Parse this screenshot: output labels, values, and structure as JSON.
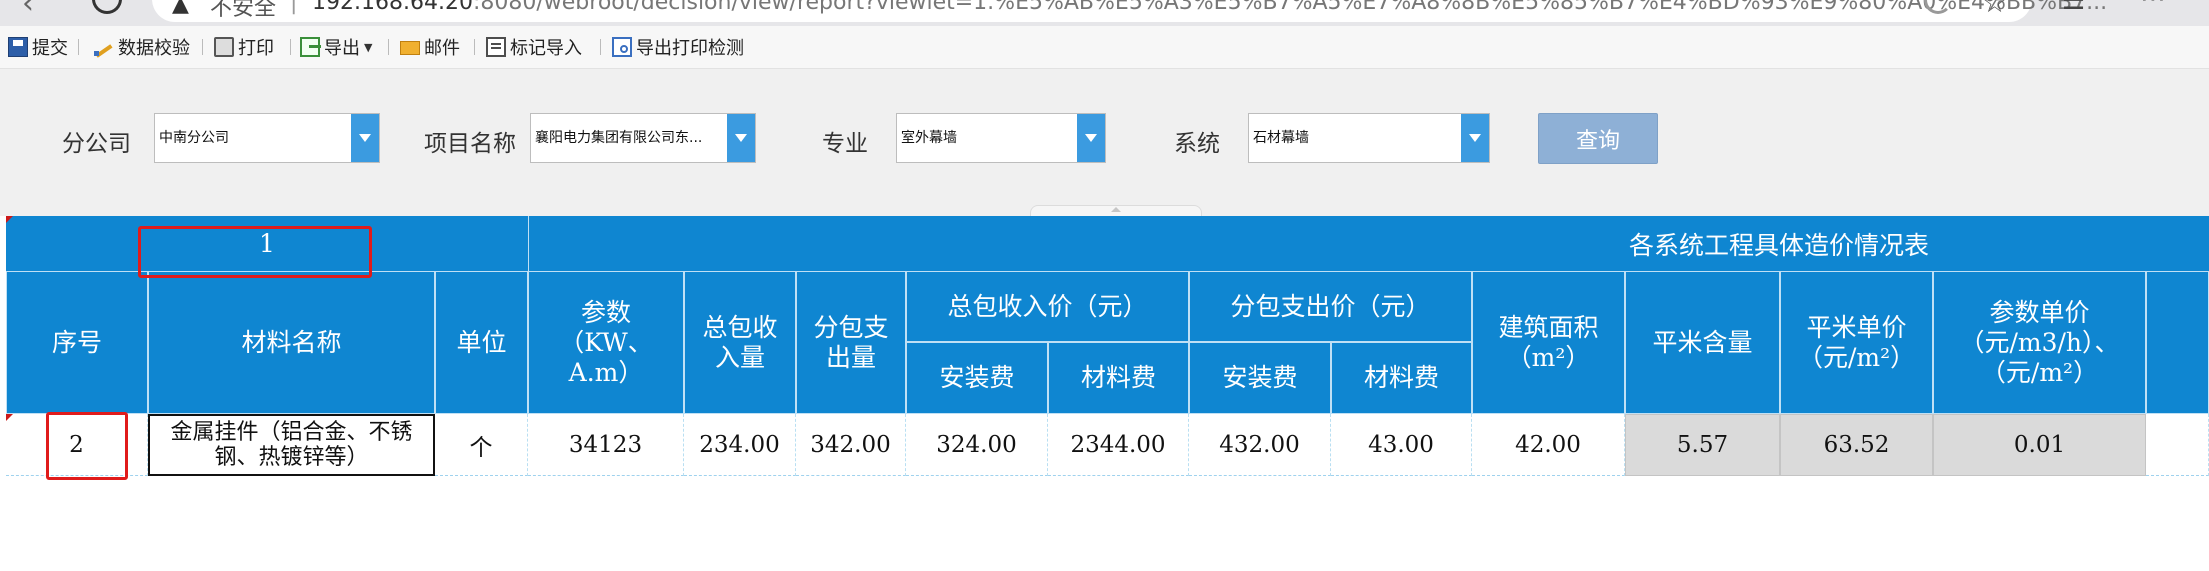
{
  "browser": {
    "security_label": "不安全",
    "separator": "|",
    "url_host": "192.168.64.20",
    "url_rest": ":8080/webroot/decision/view/report?viewlet=1.%E5%AB%E5%A3%E5%B7%A5%E7%A8%8B%E5%85%B7%E4%BD%93%E9%80%A0%E4%BB%B7..."
  },
  "toolbar": {
    "items": [
      {
        "label": "提交",
        "icon": "save-icon"
      },
      {
        "label": "数据校验",
        "icon": "validate-icon"
      },
      {
        "label": "打印",
        "icon": "print-icon"
      },
      {
        "label": "导出",
        "icon": "export-icon"
      },
      {
        "label": "邮件",
        "icon": "mail-icon"
      },
      {
        "label": "标记导入",
        "icon": "mark-import-icon"
      },
      {
        "label": "导出打印检测",
        "icon": "export-print-check-icon"
      }
    ]
  },
  "filters": {
    "company_label": "分公司",
    "company_value": "中南分公司",
    "project_label": "项目名称",
    "project_value": "襄阳电力集团有限公司东...",
    "specialty_label": "专业",
    "specialty_value": "室外幕墙",
    "system_label": "系统",
    "system_value": "石材幕墙",
    "query_label": "查询"
  },
  "report": {
    "top_left_value": "1",
    "title": "各系统工程具体造价情况表",
    "headers": {
      "seq": "序号",
      "material": "材料名称",
      "unit": "单位",
      "param": "参数（KW、A.m）",
      "total_in_qty": "总包收入量",
      "sub_out_qty": "分包支出量",
      "total_income_price": "总包收入价（元）",
      "sub_expense_price": "分包支出价（元）",
      "install_fee": "安装费",
      "material_fee": "材料费",
      "building_area": "建筑面积（m²）",
      "sqm_content": "平米含量",
      "sqm_unit_price": "平米单价（元/m²）",
      "param_unit_price": "参数单价（元/m3/h）、（元/m²）"
    },
    "row": {
      "seq": "2",
      "material": "金属挂件（铝合金、不锈钢、热镀锌等）",
      "unit": "个",
      "param": "34123",
      "total_in_qty": "234.00",
      "sub_out_qty": "342.00",
      "total_install": "324.00",
      "total_material": "2344.00",
      "sub_install": "432.00",
      "sub_material": "43.00",
      "building_area": "42.00",
      "sqm_content": "5.57",
      "sqm_unit_price": "63.52",
      "param_unit_price": "0.01"
    }
  },
  "colors": {
    "header_blue": "#0f86d1",
    "combo_button_blue": "#3b9be0",
    "query_button": "#8eb0d6",
    "highlight_red": "#e01b1b",
    "computed_gray": "#dadada"
  }
}
